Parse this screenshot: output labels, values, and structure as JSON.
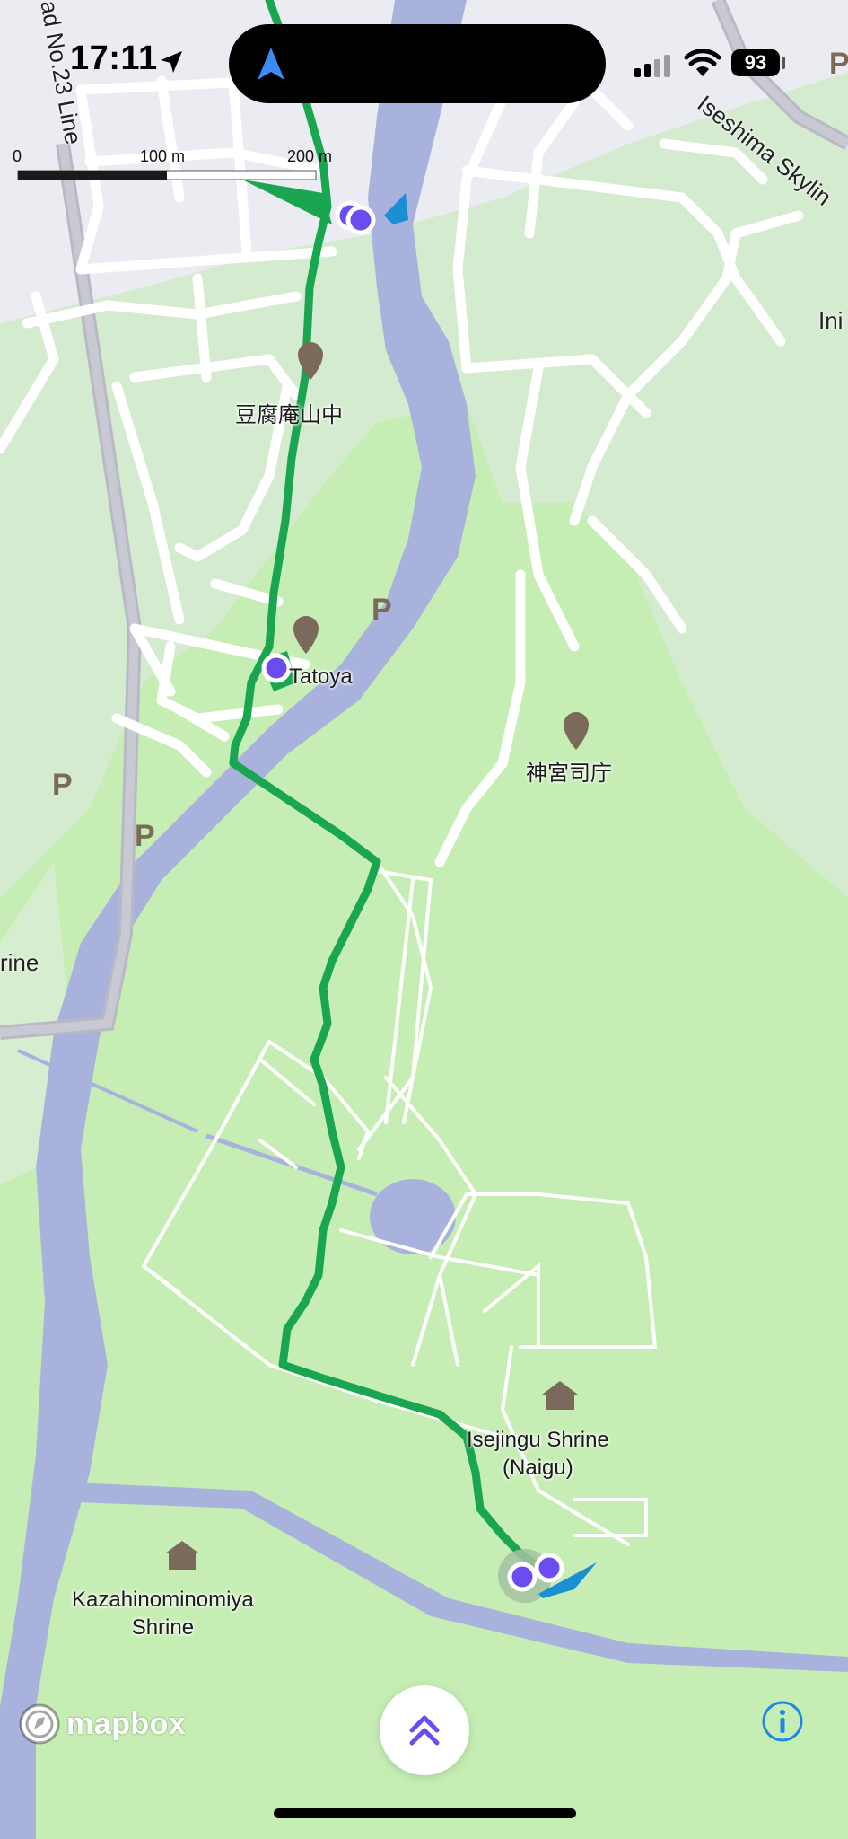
{
  "status_bar": {
    "time": "17:11",
    "battery": "93"
  },
  "scale_bar": {
    "labels": [
      "0",
      "100 m",
      "200 m"
    ]
  },
  "map": {
    "road_labels": [
      {
        "text": "ad No.23 Line"
      },
      {
        "text": "Iseshima Skylin"
      },
      {
        "text": "Ini"
      },
      {
        "text": "rine"
      }
    ],
    "place_labels": [
      {
        "text": "豆腐庵山中"
      },
      {
        "text": "Tatoya"
      },
      {
        "text": "神宮司庁"
      },
      {
        "text": "Isejingu Shrine\n(Naigu)"
      },
      {
        "text": "Kazahinominomiya\nShrine"
      }
    ],
    "parking_label": "P",
    "colors": {
      "land": "#c6eeb4",
      "urban": "#ebebf2",
      "water": "#a9b2dc",
      "road": "#ffffff",
      "track": "#1aa650",
      "waypoint": "#6a4cf0",
      "poi": "#7b6a5a"
    }
  },
  "footer": {
    "logo_text": "mapbox",
    "expand_icon": "double-chevron-up-icon",
    "info_icon": "info-icon"
  }
}
